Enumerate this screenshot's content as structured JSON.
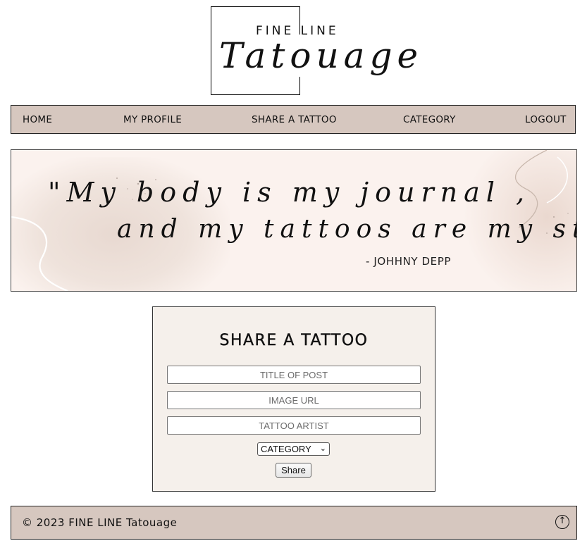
{
  "logo": {
    "line1": "FINE LINE",
    "line2": "Tatouage"
  },
  "nav": {
    "home": "HOME",
    "profile": "MY PROFILE",
    "share": "SHARE A TATTOO",
    "category": "CATEGORY",
    "logout": "LOGOUT"
  },
  "banner": {
    "quote_line1": "\"My body is my journal ,",
    "quote_line2": "and my tattoos are my story.\"",
    "author": "-  JOHHNY DEPP"
  },
  "form": {
    "heading": "SHARE A TATTOO",
    "title_placeholder": "TITLE OF POST",
    "image_placeholder": "IMAGE URL",
    "artist_placeholder": "TATTOO ARTIST",
    "category_selected": "CATEGORY",
    "submit_label": "Share"
  },
  "footer": {
    "copyright": "© 2023 FINE LINE Tatouage",
    "top_icon": "arrow-up-circle-icon"
  },
  "colors": {
    "nav_bg": "#d6c7bf",
    "card_bg": "#f5f0eb",
    "banner_bg": "#fbf2ee"
  }
}
